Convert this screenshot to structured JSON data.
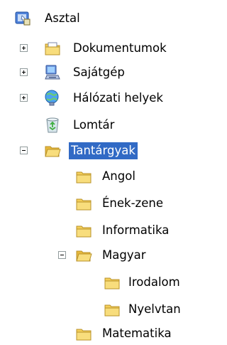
{
  "tree": {
    "desktop": {
      "label": "Asztal",
      "icon": "desktop-icon"
    },
    "documents": {
      "label": "Dokumentumok",
      "icon": "documents-folder-icon"
    },
    "my_computer": {
      "label": "Sajátgép",
      "icon": "computer-icon"
    },
    "network": {
      "label": "Hálózati helyek",
      "icon": "network-places-icon"
    },
    "recycle_bin": {
      "label": "Lomtár",
      "icon": "recycle-bin-icon"
    },
    "subjects": {
      "label": "Tantárgyak",
      "icon": "folder-open-icon",
      "selected": true
    },
    "english": {
      "label": "Angol",
      "icon": "folder-icon"
    },
    "music": {
      "label": "Ének-zene",
      "icon": "folder-icon"
    },
    "informatics": {
      "label": "Informatika",
      "icon": "folder-icon"
    },
    "hungarian": {
      "label": "Magyar",
      "icon": "folder-open-icon"
    },
    "literature": {
      "label": "Irodalom",
      "icon": "folder-icon"
    },
    "grammar": {
      "label": "Nyelvtan",
      "icon": "folder-icon"
    },
    "math": {
      "label": "Matematika",
      "icon": "folder-icon"
    }
  },
  "colors": {
    "selection": "#316ac5",
    "folder": "#f5d46b",
    "expander_border": "#919b9c"
  }
}
